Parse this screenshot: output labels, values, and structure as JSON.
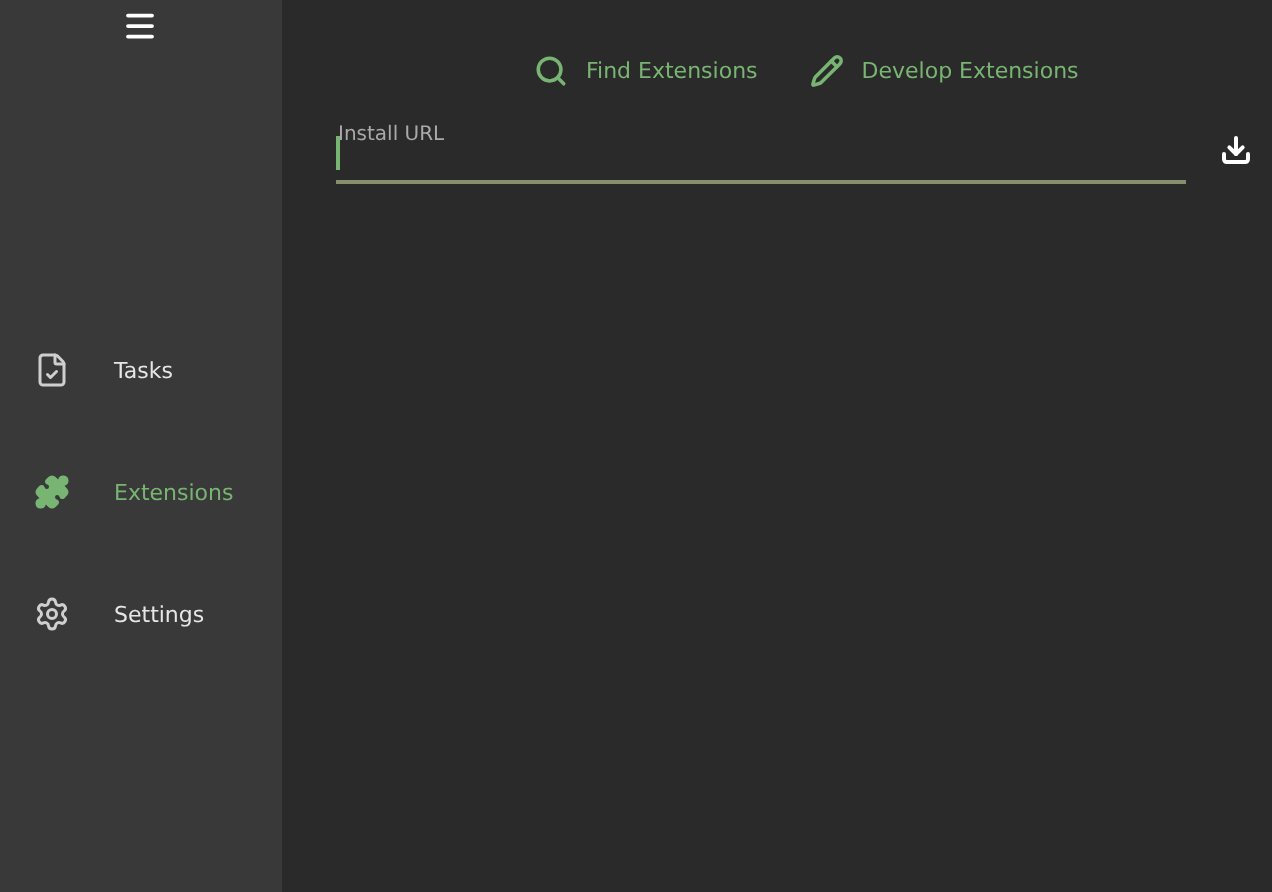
{
  "sidebar": {
    "items": [
      {
        "label": "Tasks",
        "kind": "tasks",
        "selected": false
      },
      {
        "label": "Extensions",
        "kind": "extensions",
        "selected": true
      },
      {
        "label": "Settings",
        "kind": "settings",
        "selected": false
      }
    ]
  },
  "toolbar": {
    "links": [
      {
        "label": "Find Extensions",
        "kind": "search"
      },
      {
        "label": "Develop Extensions",
        "kind": "develop"
      }
    ]
  },
  "install_field": {
    "label": "Install URL",
    "focused": true
  }
}
